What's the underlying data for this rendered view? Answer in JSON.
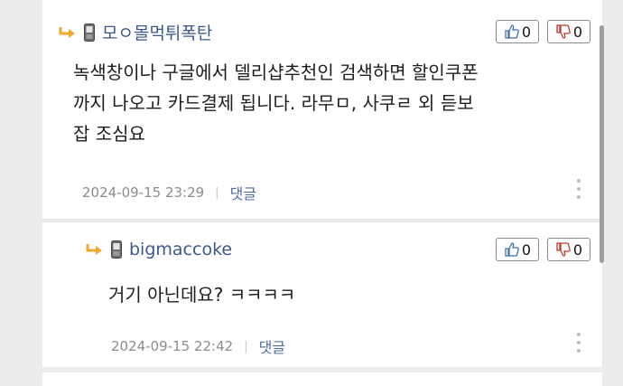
{
  "comments": [
    {
      "nickname": "모ㅇ몰먹튀폭탄",
      "upvotes": "0",
      "downvotes": "0",
      "body_lines": [
        "녹색창이나 구글에서 델리샵추천인 검색하면 할인쿠폰",
        "까지 나오고 카드결제 됩니다.  라무ㅁ, 사쿠ㄹ 외 듣보",
        "잡 조심요"
      ],
      "timestamp": "2024-09-15 23:29",
      "separator": "|",
      "reply_label": "댓글"
    },
    {
      "nickname": "bigmaccoke",
      "upvotes": "0",
      "downvotes": "0",
      "body_lines": [
        "거기 아닌데요? ㅋㅋㅋㅋ"
      ],
      "timestamp": "2024-09-15 22:42",
      "separator": "|",
      "reply_label": "댓글"
    }
  ],
  "icons": {
    "reply_arrow": "reply-arrow-icon",
    "device": "phone-icon",
    "thumbs_up": "thumbs-up-icon",
    "thumbs_down": "thumbs-down-icon",
    "more": "more-vertical-icon"
  },
  "colors": {
    "nickname": "#3b5a8c",
    "reply_arrow": "#f0a830",
    "meta": "#8c8c8c",
    "reply_link": "#4a6ea0",
    "background": "#ececec",
    "card": "#ffffff"
  }
}
